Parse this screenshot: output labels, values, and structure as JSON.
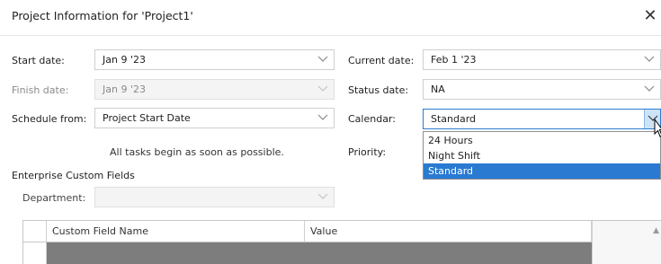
{
  "dialog": {
    "title": "Project Information for 'Project1'",
    "close_glyph": "✕"
  },
  "fields": {
    "start_date": {
      "label": "Start date:",
      "value": "Jan 9 '23"
    },
    "finish_date": {
      "label": "Finish date:",
      "value": "Jan 9 '23",
      "enabled": false
    },
    "schedule_from": {
      "label": "Schedule from:",
      "value": "Project Start Date"
    },
    "schedule_note": "All tasks begin as soon as possible.",
    "current_date": {
      "label": "Current date:",
      "value": "Feb 1 '23"
    },
    "status_date": {
      "label": "Status date:",
      "value": "NA"
    },
    "calendar": {
      "label": "Calendar:",
      "value": "Standard",
      "options": [
        "24 Hours",
        "Night Shift",
        "Standard"
      ],
      "selected_index": 2
    },
    "priority": {
      "label": "Priority:"
    }
  },
  "enterprise": {
    "section_label": "Enterprise Custom Fields",
    "department": {
      "label": "Department:",
      "value": "",
      "enabled": false
    },
    "columns": [
      "Custom Field Name",
      "Value"
    ]
  },
  "colors": {
    "accent": "#2a7ad2",
    "grid_fill": "#7d7d7d",
    "dropdown_button_hover": "#cde4f7"
  }
}
